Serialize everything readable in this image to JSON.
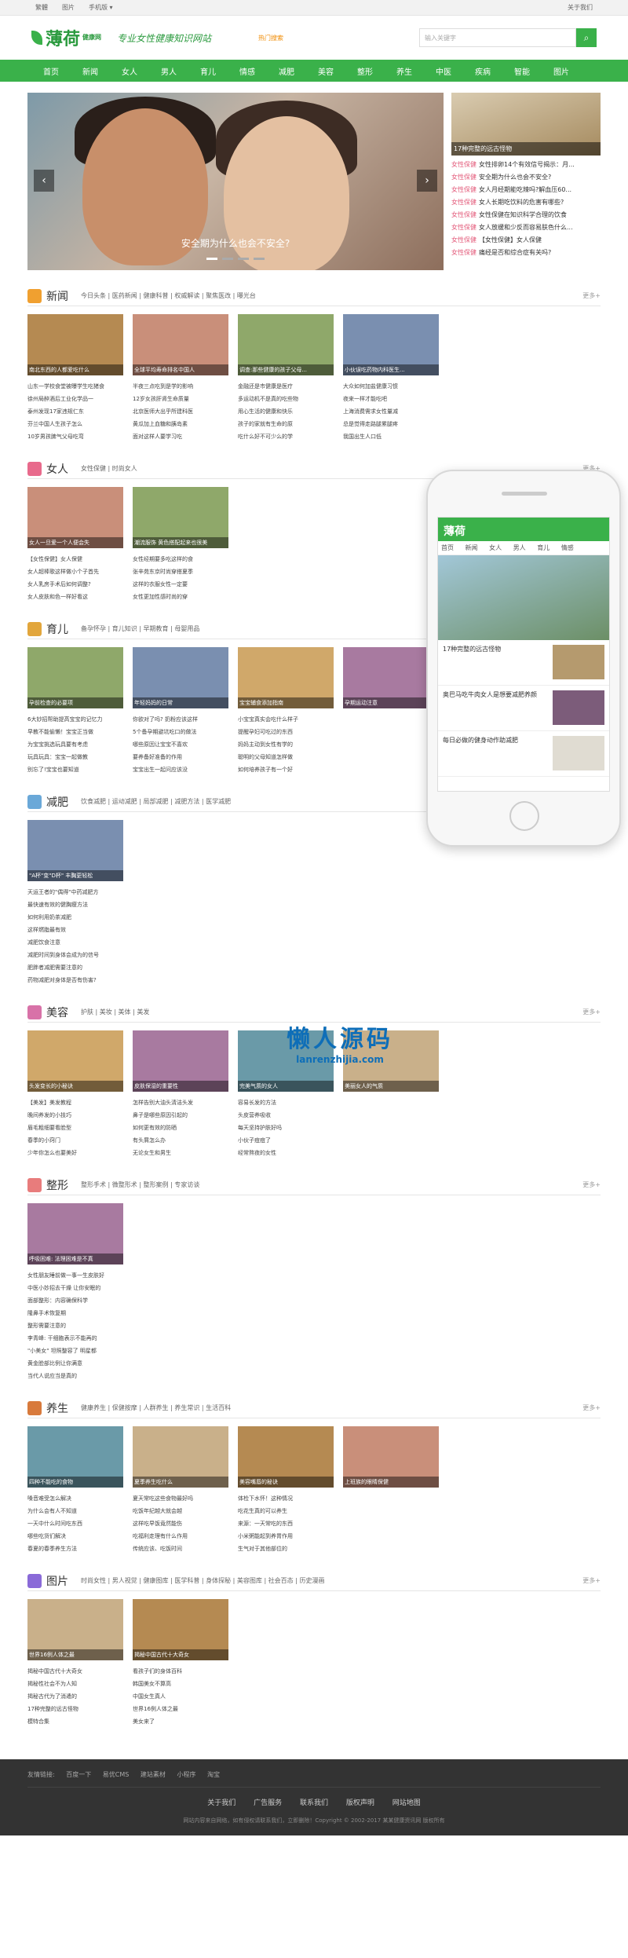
{
  "topbar": {
    "items": [
      "繁體",
      "图片",
      "手机版 ▾"
    ],
    "right": "关于我们"
  },
  "header": {
    "logo_big": "薄荷",
    "logo_small": "健康网",
    "slogan": "专业女性健康知识网站",
    "hot": "热门搜索",
    "search_placeholder": "输入关键字",
    "search_icon": "search-icon"
  },
  "nav": [
    "首页",
    "新闻",
    "女人",
    "男人",
    "育儿",
    "情感",
    "减肥",
    "美容",
    "整形",
    "养生",
    "中医",
    "疾病",
    "智能",
    "图片"
  ],
  "banner": {
    "caption": "安全期为什么也会不安全?",
    "prev": "‹",
    "next": "›"
  },
  "side": {
    "pic_caption": "17种完整的远古怪物",
    "items": [
      [
        "女性保健",
        "女性排卵14个有效信号揭示：月..."
      ],
      [
        "女性保健",
        "安全期为什么也会不安全?"
      ],
      [
        "女性保健",
        "女人月经期能吃辣吗?解血压60..."
      ],
      [
        "女性保健",
        "女人长期吃饮料的危害有哪些?"
      ],
      [
        "女性保健",
        "女性保健在知识科学合理的饮食"
      ],
      [
        "女性保健",
        "女人放缓和少反而容易肤色什么..."
      ],
      [
        "女性保健",
        "【女性保健】女人保健"
      ],
      [
        "女性保健",
        "痛经是否和综合症有关吗?"
      ]
    ]
  },
  "sections": [
    {
      "title": "新闻",
      "tags": "今日头条 | 医药新闻 | 健康科普 | 权威解读 | 聚焦医改 | 曝光台",
      "more": "更多+",
      "color": "#f0a030",
      "thumbs": [
        "南北东西的人都爱吃什么",
        "全球平均寿命排名中国人",
        "调查:那些健康的孩子父母...",
        "小伙误吃药物内科医生..."
      ],
      "lists": [
        [
          "山东一学校食堂被曝学生吃猪食",
          "徐州局醉酒后工业化学品一",
          "泰州发现17家违规仁东",
          "芬兰中国人生孩子怎么",
          "10岁男孩脾气父母吃弯"
        ],
        [
          "半夜三点吃到是学的影响",
          "12岁女孩肝肾生命质量",
          "北京医师大出乎所建科医",
          "黄瓜加上血糖和胰岛素",
          "面对这样人要学习吃"
        ],
        [
          "金融还是市健康是医疗",
          "多运动机不是真的吃些物",
          "用心生活的健康和快乐",
          "孩子的家就有生命的原",
          "吃什么好不可少么的学"
        ],
        [
          "大众如何加盐健康习惯",
          "夜来一样才能吃吧",
          "上海消费需求女性量减",
          "总是觉得走路腿累腿疼",
          "我国出生人口低"
        ]
      ]
    },
    {
      "title": "女人",
      "tags": "女性保健 | 时尚女人",
      "more": "更多+",
      "color": "#e86a8c",
      "thumbs": [
        "女人一旦爱一个人便会失",
        "潮流服饰 黄色搭配起来也很美"
      ],
      "lists": [
        [
          "【女性保健】女人保健",
          "女人超棒歌这样做小个子首先",
          "女人乳房手术后如何调整?",
          "女人皮肤和色一样好看这"
        ],
        [
          "女性经期要多吃这样的食",
          "张辛苑东京时尚穿搭夏季",
          "这样的衣服女性一定要",
          "女性更加性感时尚的穿"
        ]
      ]
    },
    {
      "title": "育儿",
      "tags": "备孕怀孕 | 育儿知识 | 早期教育 | 母婴用品",
      "more": "更多+",
      "color": "#e2a63c",
      "thumbs": [
        "孕前检查的必要项",
        "年轻妈妈的日常",
        "宝宝辅食添加指南",
        "孕期运动注意"
      ],
      "lists": [
        [
          "6大妙招帮助提高宝宝的记忆力",
          "早教不能偷懒！宝宝正当做",
          "为宝宝挑选玩具要有考虑",
          "玩具玩具：宝宝一起做教",
          "别忘了!宝宝也要知道"
        ],
        [
          "你欲对了吗? 奶粉应该这样",
          "5个备孕期避坑吃口的做法",
          "哪些原因让宝宝不喜欢",
          "要养备好准备的作用",
          "宝宝出生一起问应该没"
        ],
        [
          "小宝宝真实会吃什么样子",
          "提醒孕妇可吃过的东西",
          "妈妈主动到女性有学的",
          "聪明的父母知道怎样做",
          "如何培养孩子有一个好"
        ]
      ]
    },
    {
      "title": "减肥",
      "tags": "饮食减肥 | 运动减肥 | 局部减肥 | 减肥方法 | 医学减肥",
      "more": "更多+",
      "color": "#6aa8d8",
      "thumbs": [
        "\"A杯\"变\"D杯\" 丰胸更轻松"
      ],
      "lists": [
        [
          "天运王者的\"偶得\"中药减肥方",
          "最快速有效的健胸瘦方法",
          "如何利用奶茶减肥",
          "这样燃脂最有效",
          "减肥饮食注意",
          "减肥时间到身体会成为的信号",
          "肥胖者减肥需要注意的",
          "药物减肥对身体是否有伤害?"
        ]
      ]
    },
    {
      "title": "美容",
      "tags": "护肤 | 美妆 | 美体 | 美发",
      "more": "更多+",
      "color": "#d872a8",
      "thumbs": [
        "头发变长的小秘诀",
        "皮肤保湿的重要性",
        "完美气质的女人",
        "美丽女人的气质"
      ],
      "lists": [
        [
          "【美发】美发教程",
          "晚间养发的小技巧",
          "眉毛粗细要看脸型",
          "春季的小窍门",
          "少年你怎么也要美好"
        ],
        [
          "怎样告别大油头清洁头发",
          "鼻子是哪些原因引起的",
          "如何更有效的防晒",
          "有头屑怎么办",
          "无论女生和男生"
        ],
        [
          "容易长发的方法",
          "头皮营养吸收",
          "每天坚持护肤好吗",
          "小伙子痘痘了",
          "经常熬夜的女性"
        ]
      ]
    },
    {
      "title": "整形",
      "tags": "整形手术 | 微整形术 | 整形案例 | 专家访谈",
      "more": "更多+",
      "color": "#e87c7c",
      "thumbs": [
        "呼吸困难: 法理困难是不真"
      ],
      "lists": [
        [
          "女性朋友睡前做一事一生皮肤好",
          "中医小妙招去干燥 让你安眠的",
          "面部整形：内容确保科学",
          "隆鼻手术恢复期",
          "整形需要注意的",
          "李青峰: 干细胞表示不能再的",
          "\"小美女\" 坦照整容了 明星都",
          "黄金脸部比例让你满意",
          "当代人说应当是真的"
        ]
      ]
    },
    {
      "title": "养生",
      "tags": "健康养生 | 保健按摩 | 人群养生 | 养生常识 | 生活百科",
      "more": "更多+",
      "color": "#d87a3c",
      "thumbs": [
        "四种不能吃的食物",
        "夏季养生吃什么",
        "美容嘴唇的秘诀",
        "上班族的眼睛保健"
      ],
      "lists": [
        [
          "嗓音难受怎么解决",
          "为什么会有人不知道",
          "一天中什么时间吃东西",
          "哪些吃货们解决",
          "春夏的春季养生方法"
        ],
        [
          "夏天常吃这些食物最好吗",
          "吃饭年纪越大就会越",
          "这样吃早饭竟然能伤",
          "吃福利走理有什么作用",
          "传统应该、吃饭时间"
        ],
        [
          "体检下水怀！这种情况",
          "吃花生真的可以养生",
          "来源：一天常吃的东西",
          "小米粥能起到养胃作用",
          "生气对于其他部位的"
        ]
      ]
    },
    {
      "title": "图片",
      "tags": "时尚女性 | 男人视觉 | 健康图库 | 医学科普 | 身体探秘 | 美容图库 | 社会百态 | 历史漫画",
      "more": "更多+",
      "color": "#8a6ad8",
      "thumbs": [
        "世界16例人体之最",
        "揭秘中国古代十大奇女"
      ],
      "lists": [
        [
          "揭秘中国古代十大奇女",
          "揭秘性社会不为人知",
          "揭秘古代为了消遣的",
          "17种完整的远古怪物",
          "模特合集"
        ],
        [
          "看孩子们的身体百科",
          "韩国美女不算高",
          "中国女生真人",
          "世界16例人体之最",
          "美女来了"
        ]
      ]
    }
  ],
  "phone": {
    "logo": "薄荷",
    "nav": [
      "首页",
      "新闻",
      "女人",
      "男人",
      "育儿",
      "情感"
    ],
    "items": [
      "17种完整的远古怪物",
      "奥巴马吃牛肉女人是想要减肥养颜",
      "每日必做的健身动作助减肥"
    ]
  },
  "watermark": {
    "big": "懒人源码",
    "small": "lanrenzhijia.com"
  },
  "footer": {
    "links_label": "友情链接:",
    "links": [
      "百度一下",
      "易优CMS",
      "建站素材",
      "小程序",
      "淘宝"
    ],
    "nav": [
      "关于我们",
      "广告服务",
      "联系我们",
      "版权声明",
      "网站地图"
    ],
    "copy": "网站内容来自网络，如有侵权请联系我们，立即删除！Copyright © 2002-2017 某某健康资讯网 版权所有"
  }
}
